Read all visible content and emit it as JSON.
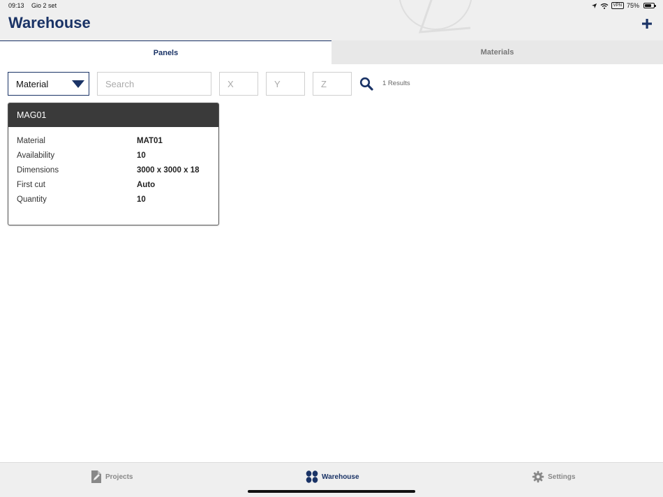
{
  "status_bar": {
    "time": "09:13",
    "date": "Gio 2 set",
    "vpn": "VPN",
    "battery": "75%",
    "battery_level": 0.75
  },
  "header": {
    "title": "Warehouse",
    "add_icon": "plus-icon"
  },
  "tabs": [
    {
      "label": "Panels",
      "active": true
    },
    {
      "label": "Materials",
      "active": false
    }
  ],
  "filters": {
    "type_select": "Material",
    "search_placeholder": "Search",
    "x_placeholder": "X",
    "y_placeholder": "Y",
    "z_placeholder": "Z",
    "results": "1 Results"
  },
  "cards": [
    {
      "title": "MAG01",
      "rows": [
        {
          "key": "Material",
          "value": "MAT01"
        },
        {
          "key": "Availability",
          "value": "10"
        },
        {
          "key": "Dimensions",
          "value": "3000 x 3000 x 18"
        },
        {
          "key": "First cut",
          "value": "Auto"
        },
        {
          "key": "Quantity",
          "value": "10"
        }
      ]
    }
  ],
  "bottom_nav": [
    {
      "label": "Projects",
      "icon": "document-edit-icon",
      "active": false
    },
    {
      "label": "Warehouse",
      "icon": "four-dots-icon",
      "active": true
    },
    {
      "label": "Settings",
      "icon": "gear-icon",
      "active": false
    }
  ],
  "colors": {
    "primary": "#1a3366",
    "card_header": "#3a3a3a",
    "inactive": "#888888",
    "background": "#efefef"
  }
}
